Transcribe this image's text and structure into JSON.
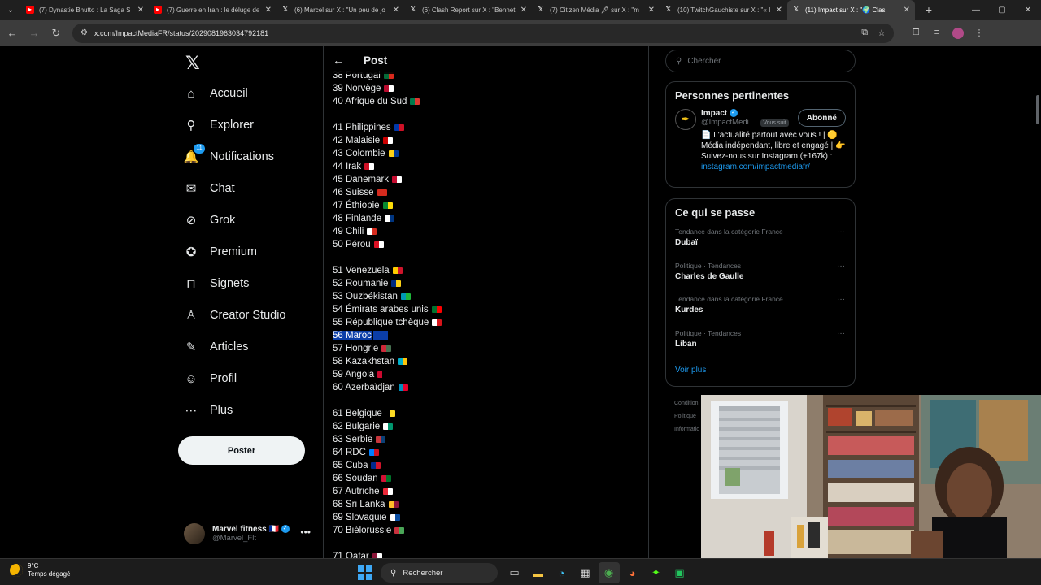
{
  "browser": {
    "tabs": [
      {
        "label": "(7) Dynastie Bhutto : La Saga S",
        "icon": "youtube-icon"
      },
      {
        "label": "(7) Guerre en Iran : le déluge de",
        "icon": "youtube-icon"
      },
      {
        "label": "(6) Marcel sur X : \"Un peu de jo",
        "icon": "x-icon"
      },
      {
        "label": "(6) Clash Report sur X : \"Bennet",
        "icon": "x-icon"
      },
      {
        "label": "(7) Citizen Média 🖋 sur X : \"m",
        "icon": "x-icon"
      },
      {
        "label": "(10) TwitchGauchiste sur X : \"« I",
        "icon": "x-icon"
      },
      {
        "label": "(11) Impact sur X : \"🌍 Clas",
        "icon": "x-icon",
        "active": true
      }
    ],
    "url": "x.com/ImpactMediaFR/status/2029081963034792181"
  },
  "sidebar": {
    "items": [
      {
        "label": "Accueil",
        "icon": "home-icon",
        "glyph": "⌂"
      },
      {
        "label": "Explorer",
        "icon": "search-icon",
        "glyph": "⚲"
      },
      {
        "label": "Notifications",
        "icon": "bell-icon",
        "glyph": "🔔",
        "badge": "11"
      },
      {
        "label": "Chat",
        "icon": "mail-icon",
        "glyph": "✉"
      },
      {
        "label": "Grok",
        "icon": "grok-icon",
        "glyph": "⊘"
      },
      {
        "label": "Premium",
        "icon": "premium-icon",
        "glyph": "✪"
      },
      {
        "label": "Signets",
        "icon": "bookmark-icon",
        "glyph": "⊓"
      },
      {
        "label": "Creator Studio",
        "icon": "creator-studio-icon",
        "glyph": "♙"
      },
      {
        "label": "Articles",
        "icon": "articles-icon",
        "glyph": "✎"
      },
      {
        "label": "Profil",
        "icon": "profile-icon",
        "glyph": "☺"
      },
      {
        "label": "Plus",
        "icon": "more-icon",
        "glyph": "⋯"
      }
    ],
    "post_button": "Poster",
    "account": {
      "name": "Marvel fitness",
      "flag": "🇫🇷",
      "handle": "@Marvel_Flt"
    }
  },
  "post": {
    "header_title": "Post",
    "rows": [
      {
        "text": "38 Portugal",
        "flag": [
          "#046a38",
          "#da291c"
        ]
      },
      {
        "text": "39 Norvège",
        "flag": [
          "#ba0c2f",
          "#ffffff"
        ]
      },
      {
        "text": "40 Afrique du Sud",
        "flag": [
          "#007a4d",
          "#de3831"
        ]
      },
      {
        "gap": true
      },
      {
        "text": "41 Philippines",
        "flag": [
          "#0038a8",
          "#ce1126"
        ]
      },
      {
        "text": "42 Malaisie",
        "flag": [
          "#cc0001",
          "#ffffff"
        ]
      },
      {
        "text": "43 Colombie",
        "flag": [
          "#fcd116",
          "#003893"
        ]
      },
      {
        "text": "44 Irak",
        "flag": [
          "#ce1126",
          "#ffffff"
        ]
      },
      {
        "text": "45 Danemark",
        "flag": [
          "#c60c30",
          "#ffffff"
        ]
      },
      {
        "text": "46 Suisse",
        "flag": [
          "#d52b1e",
          "#d52b1e"
        ]
      },
      {
        "text": "47 Éthiopie",
        "flag": [
          "#078930",
          "#fcdd09"
        ]
      },
      {
        "text": "48 Finlande",
        "flag": [
          "#ffffff",
          "#003580"
        ]
      },
      {
        "text": "49 Chili",
        "flag": [
          "#ffffff",
          "#d52b1e"
        ]
      },
      {
        "text": "50 Pérou",
        "flag": [
          "#d91023",
          "#ffffff"
        ]
      },
      {
        "gap": true
      },
      {
        "text": "51 Venezuela",
        "flag": [
          "#ffcc00",
          "#cf142b"
        ]
      },
      {
        "text": "52 Roumanie",
        "flag": [
          "#002b7f",
          "#fcd116"
        ]
      },
      {
        "text": "53 Ouzbékistan",
        "flag": [
          "#0099b5",
          "#1eb53a"
        ]
      },
      {
        "text": "54 Émirats arabes unis",
        "flag": [
          "#00732f",
          "#ff0000"
        ]
      },
      {
        "text": "55 République tchèque",
        "flag": [
          "#ffffff",
          "#d7141a"
        ]
      },
      {
        "text": "56 Maroc",
        "selected": true
      },
      {
        "text": "57 Hongrie",
        "flag": [
          "#ce2939",
          "#477050"
        ]
      },
      {
        "text": "58 Kazakhstan",
        "flag": [
          "#00afca",
          "#fec50c"
        ]
      },
      {
        "text": "59 Angola",
        "flag": [
          "#cc092f",
          "#000000"
        ]
      },
      {
        "text": "60 Azerbaïdjan",
        "flag": [
          "#0092bc",
          "#e4002b"
        ]
      },
      {
        "gap": true
      },
      {
        "text": "61 Belgique",
        "flag": [
          "#000000",
          "#fdda24"
        ]
      },
      {
        "text": "62 Bulgarie",
        "flag": [
          "#ffffff",
          "#00966e"
        ]
      },
      {
        "text": "63 Serbie",
        "flag": [
          "#c6363c",
          "#0c4076"
        ]
      },
      {
        "text": "64 RDC",
        "flag": [
          "#007fff",
          "#ce1021"
        ]
      },
      {
        "text": "65 Cuba",
        "flag": [
          "#002a8f",
          "#cf142b"
        ]
      },
      {
        "text": "66 Soudan",
        "flag": [
          "#d21034",
          "#007229"
        ]
      },
      {
        "text": "67 Autriche",
        "flag": [
          "#ed2939",
          "#ffffff"
        ]
      },
      {
        "text": "68 Sri Lanka",
        "flag": [
          "#ffbe29",
          "#8d153a"
        ]
      },
      {
        "text": "69 Slovaquie",
        "flag": [
          "#ffffff",
          "#0b4ea2"
        ]
      },
      {
        "text": "70 Biélorussie",
        "flag": [
          "#c8313e",
          "#4aa657"
        ]
      },
      {
        "gap": true
      },
      {
        "text": "71 Qatar",
        "flag": [
          "#8a1538",
          "#ffffff"
        ]
      }
    ]
  },
  "right": {
    "search_placeholder": "Chercher",
    "relevant": {
      "title": "Personnes pertinentes",
      "name": "Impact",
      "handle": "@ImpactMedi...",
      "follows_you": "Vous suit",
      "button": "Abonné",
      "bio": "📄 L'actualité partout avec vous ! | 🟡 Média indépendant, libre et engagé | 👉 Suivez-nous sur Instagram (+167k) :",
      "link": "instagram.com/impactmediafr/"
    },
    "trends": {
      "title": "Ce qui se passe",
      "items": [
        {
          "context": "Tendance dans la catégorie France",
          "name": "Dubaï"
        },
        {
          "context": "Politique · Tendances",
          "name": "Charles de Gaulle"
        },
        {
          "context": "Tendance dans la catégorie France",
          "name": "Kurdes"
        },
        {
          "context": "Politique · Tendances",
          "name": "Liban"
        }
      ],
      "more": "Voir plus"
    },
    "footer": [
      "Condition",
      "Politique",
      "Informatio"
    ]
  },
  "taskbar": {
    "temp": "9°C",
    "weather": "Temps dégagé",
    "search": "Rechercher"
  }
}
